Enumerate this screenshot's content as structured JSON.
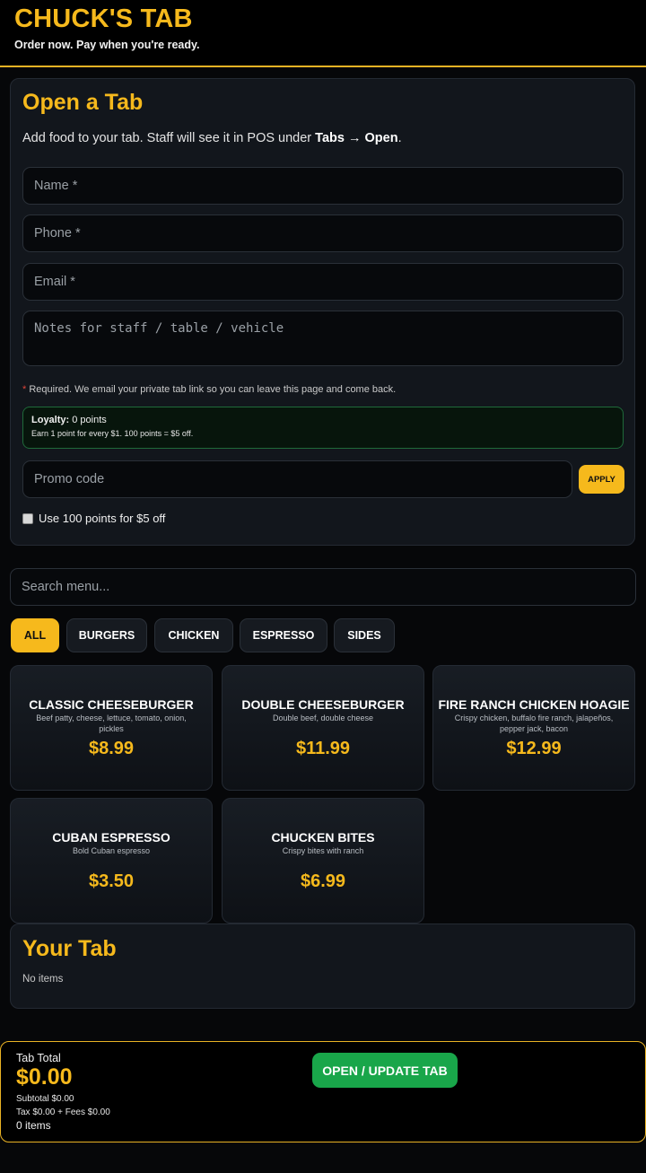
{
  "header": {
    "title": "CHUCK'S TAB",
    "tagline": "Order now. Pay when you're ready."
  },
  "open_tab": {
    "heading": "Open a Tab",
    "intro_prefix": "Add food to your tab. Staff will see it in POS under ",
    "intro_tabs": "Tabs",
    "intro_arrow": " → ",
    "intro_open": "Open",
    "intro_suffix": ".",
    "name_placeholder": "Name *",
    "phone_placeholder": "Phone *",
    "email_placeholder": "Email *",
    "notes_placeholder": "Notes for staff / table / vehicle",
    "required_star": "*",
    "required_note": " Required. We email your private tab link so you can leave this page and come back.",
    "loyalty_label": "Loyalty:",
    "loyalty_points": " 0 points",
    "loyalty_sub": "Earn 1 point for every $1. 100 points = $5 off.",
    "promo_placeholder": "Promo code",
    "apply_label": "APPLY",
    "use_points_label": "Use 100 points for $5 off"
  },
  "search": {
    "placeholder": "Search menu..."
  },
  "categories": [
    "ALL",
    "BURGERS",
    "CHICKEN",
    "ESPRESSO",
    "SIDES"
  ],
  "active_category": "ALL",
  "menu_items": [
    {
      "name": "CLASSIC CHEESEBURGER",
      "desc": "Beef patty, cheese, lettuce, tomato, onion, pickles",
      "price": "$8.99"
    },
    {
      "name": "DOUBLE CHEESEBURGER",
      "desc": "Double beef, double cheese",
      "price": "$11.99"
    },
    {
      "name": "FIRE RANCH CHICKEN HOAGIE",
      "desc": "Crispy chicken, buffalo fire ranch, jalapeños, pepper jack, bacon",
      "price": "$12.99"
    },
    {
      "name": "CUBAN ESPRESSO",
      "desc": "Bold Cuban espresso",
      "price": "$3.50"
    },
    {
      "name": "CHUCKEN BITES",
      "desc": "Crispy bites with ranch",
      "price": "$6.99"
    }
  ],
  "your_tab": {
    "heading": "Your Tab",
    "empty_text": "No items"
  },
  "footer": {
    "label": "Tab Total",
    "total": "$0.00",
    "subtotal": "Subtotal $0.00",
    "tax_fees": "Tax $0.00 + Fees $0.00",
    "count": "0 items",
    "button_label": "OPEN / UPDATE TAB"
  },
  "colors": {
    "accent": "#f6b91c",
    "success": "#19a64a",
    "background": "#060709"
  }
}
